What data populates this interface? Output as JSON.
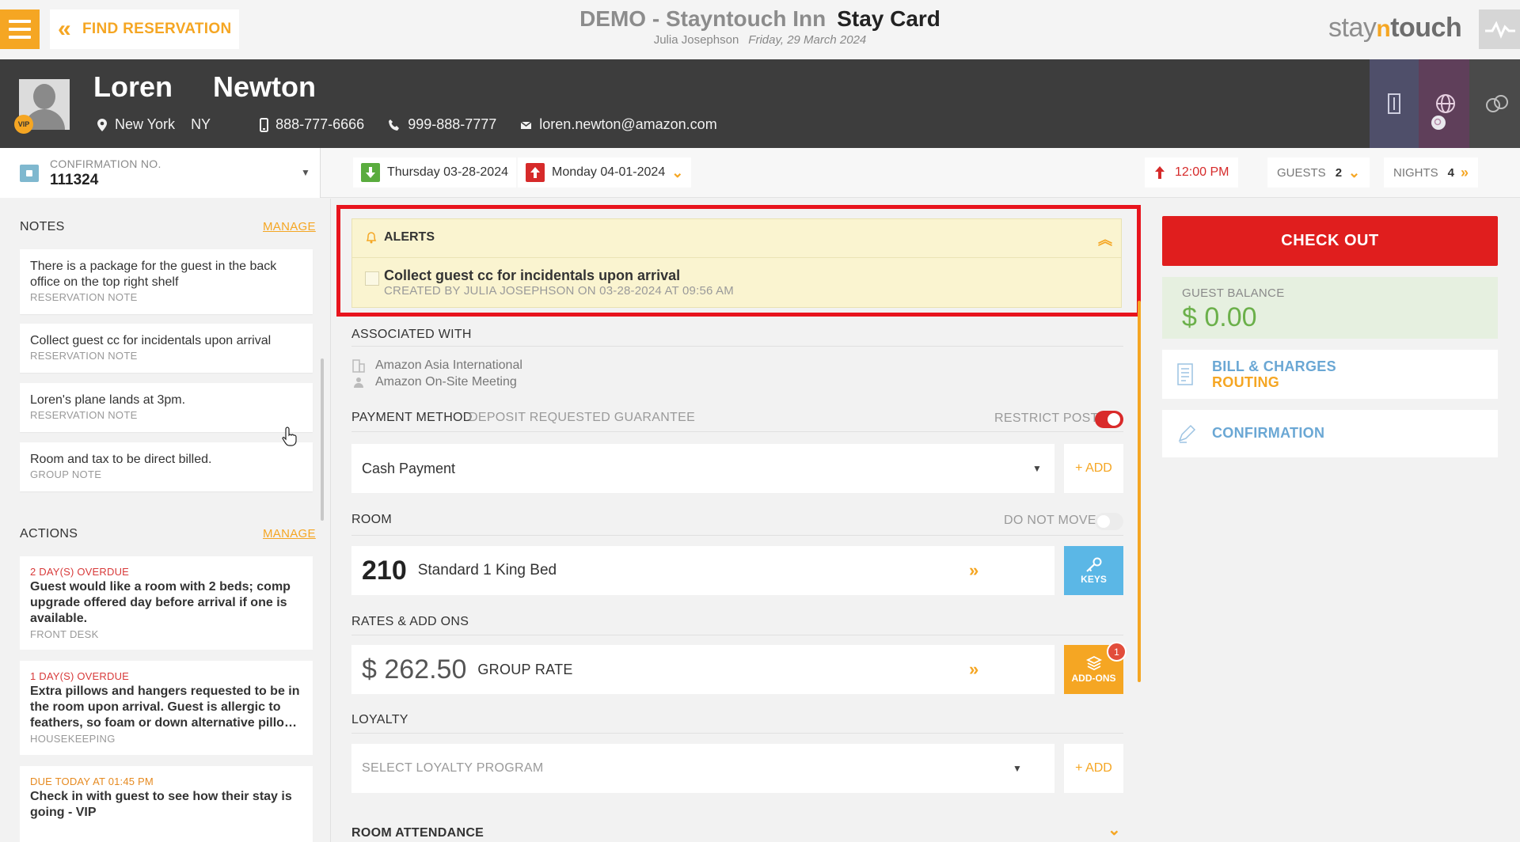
{
  "topbar": {
    "find_reservation": "FIND RESERVATION",
    "hotel_name": "DEMO - Stayntouch Inn",
    "page_title": "Stay Card",
    "user_name": "Julia Josephson",
    "business_date": "Friday, 29 March 2024",
    "brand_part1": "stay",
    "brand_part2": "n",
    "brand_part3": "touch"
  },
  "guest": {
    "first_name": "Loren",
    "last_name": "Newton",
    "vip_badge": "VIP",
    "city": "New York",
    "state": "NY",
    "mobile": "888-777-6666",
    "phone": "999-888-7777",
    "email": "loren.newton@amazon.com"
  },
  "reservation": {
    "confirmation_label": "CONFIRMATION NO.",
    "confirmation_number": "111324",
    "arrival": "Thursday 03-28-2024",
    "departure": "Monday 04-01-2024",
    "departure_time": "12:00 PM",
    "guests_label": "GUESTS",
    "guests_count": "2",
    "nights_label": "NIGHTS",
    "nights_count": "4"
  },
  "notes": {
    "heading": "NOTES",
    "manage": "MANAGE",
    "items": [
      {
        "text": "There is a package for the guest in the back office on the top right shelf",
        "type": "RESERVATION NOTE"
      },
      {
        "text": "Collect guest cc for incidentals upon arrival",
        "type": "RESERVATION NOTE"
      },
      {
        "text": "Loren's plane lands at 3pm.",
        "type": "RESERVATION NOTE"
      },
      {
        "text": "Room and tax to be direct billed.",
        "type": "GROUP NOTE"
      }
    ]
  },
  "actions": {
    "heading": "ACTIONS",
    "manage": "MANAGE",
    "items": [
      {
        "due": "2 DAY(S) OVERDUE",
        "text": "Guest would like a room with 2 beds; comp upgrade offered day before arrival if one is available.",
        "dept": "FRONT DESK"
      },
      {
        "due": "1 DAY(S) OVERDUE",
        "text": "Extra pillows and hangers requested to be in the room upon arrival. Guest is allergic to feathers, so foam or down alternative pillo…",
        "dept": "HOUSEKEEPING"
      },
      {
        "due": "DUE TODAY AT 01:45 PM",
        "text": "Check in with guest to see how their stay is going - VIP",
        "dept": ""
      }
    ]
  },
  "alerts": {
    "heading": "ALERTS",
    "item_text": "Collect guest cc for incidentals upon arrival",
    "item_meta": "CREATED BY JULIA JOSEPHSON ON 03-28-2024 AT 09:56 AM"
  },
  "associated": {
    "heading": "ASSOCIATED WITH",
    "company": "Amazon Asia International",
    "group": "Amazon On-Site Meeting"
  },
  "payment": {
    "heading": "PAYMENT METHOD",
    "subheading": "DEPOSIT REQUESTED GUARANTEE",
    "restrict_post": "RESTRICT POST",
    "method": "Cash Payment",
    "add": "+ ADD"
  },
  "room": {
    "heading": "ROOM",
    "do_not_move": "DO NOT MOVE",
    "number": "210",
    "type": "Standard 1 King Bed",
    "keys": "KEYS"
  },
  "rates": {
    "heading": "RATES & ADD ONS",
    "amount": "$ 262.50",
    "rate_name": "GROUP RATE",
    "addons": "ADD-ONS",
    "addons_count": "1"
  },
  "loyalty": {
    "heading": "LOYALTY",
    "placeholder": "SELECT LOYALTY PROGRAM",
    "add": "+ ADD"
  },
  "room_attendance": {
    "heading": "ROOM ATTENDANCE"
  },
  "sidebar": {
    "checkout": "CHECK OUT",
    "balance_label": "GUEST BALANCE",
    "balance_value": "$ 0.00",
    "bill_line1": "BILL & CHARGES",
    "bill_line2": "ROUTING",
    "confirmation": "CONFIRMATION"
  },
  "colors": {
    "accent": "#f5a623",
    "alert_outline": "#e8141d",
    "checkout": "#e01e1e",
    "balance": "#6bb04a",
    "link": "#6aa7d4",
    "header_bg": "#3d3d3d"
  }
}
